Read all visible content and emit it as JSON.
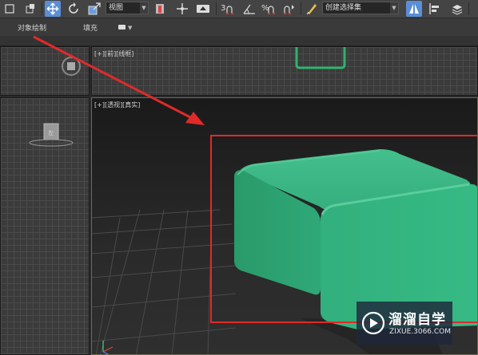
{
  "toolbar": {
    "view_select": "视图",
    "selection_set": "创建选择集"
  },
  "ribbon": {
    "tabs": [
      "对象绘制",
      "填充"
    ]
  },
  "viewports": {
    "top_label": "[+][前][线框]",
    "persp_label": "[+][透视][真实]"
  },
  "watermark": {
    "title": "溜溜自学",
    "url": "ZIXUE.3066.COM"
  },
  "colors": {
    "box_green": "#2fa877",
    "highlight_red": "#e02a2a",
    "select_blue": "#5a8ed6"
  }
}
